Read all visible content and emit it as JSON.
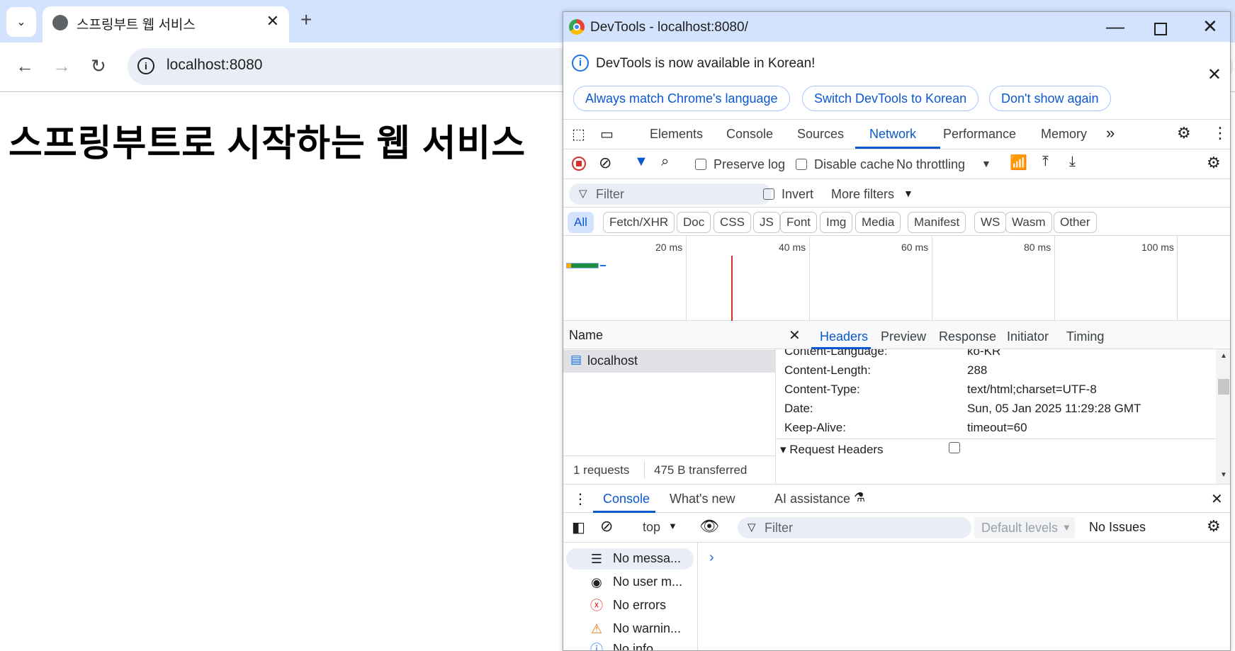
{
  "browser": {
    "tab_title": "스프링부트 웹 서비스",
    "url": "localhost:8080"
  },
  "page": {
    "heading": "스프링부트로 시작하는 웹 서비스"
  },
  "devtools": {
    "window_title": "DevTools - localhost:8080/",
    "infobar": {
      "message": "DevTools is now available in Korean!",
      "buttons": [
        "Always match Chrome's language",
        "Switch DevTools to Korean",
        "Don't show again"
      ]
    },
    "tabs": [
      "Elements",
      "Console",
      "Sources",
      "Network",
      "Performance",
      "Memory"
    ],
    "active_tab": "Network",
    "network_toolbar": {
      "preserve_log": "Preserve log",
      "disable_cache": "Disable cache",
      "throttling": "No throttling"
    },
    "filter": {
      "placeholder": "Filter",
      "invert": "Invert",
      "more_filters": "More filters"
    },
    "types": [
      "All",
      "Fetch/XHR",
      "Doc",
      "CSS",
      "JS",
      "Font",
      "Img",
      "Media",
      "Manifest",
      "WS",
      "Wasm",
      "Other"
    ],
    "timeline_ticks": [
      "20 ms",
      "40 ms",
      "60 ms",
      "80 ms",
      "100 ms"
    ],
    "requests": {
      "column_name": "Name",
      "rows": [
        "localhost"
      ],
      "summary_count": "1 requests",
      "summary_transferred": "475 B transferred"
    },
    "detail_tabs": [
      "Headers",
      "Preview",
      "Response",
      "Initiator",
      "Timing"
    ],
    "active_detail_tab": "Headers",
    "headers": [
      {
        "name": "Content-Language:",
        "value": "ko-KR"
      },
      {
        "name": "Content-Length:",
        "value": "288"
      },
      {
        "name": "Content-Type:",
        "value": "text/html;charset=UTF-8"
      },
      {
        "name": "Date:",
        "value": "Sun, 05 Jan 2025 11:29:28 GMT"
      },
      {
        "name": "Keep-Alive:",
        "value": "timeout=60"
      }
    ],
    "request_headers_section": "▾ Request Headers",
    "drawer": {
      "tabs": [
        "Console",
        "What's new",
        "AI assistance"
      ],
      "context": "top",
      "filter_placeholder": "Filter",
      "levels": "Default levels",
      "issues": "No Issues",
      "sidebar": [
        "No messa...",
        "No user m...",
        "No errors",
        "No warnin...",
        "No info"
      ],
      "prompt": "›"
    },
    "colors": {
      "accent": "#0b57d0",
      "titlebar": "#d3e3fd",
      "record": "#d93025"
    }
  }
}
